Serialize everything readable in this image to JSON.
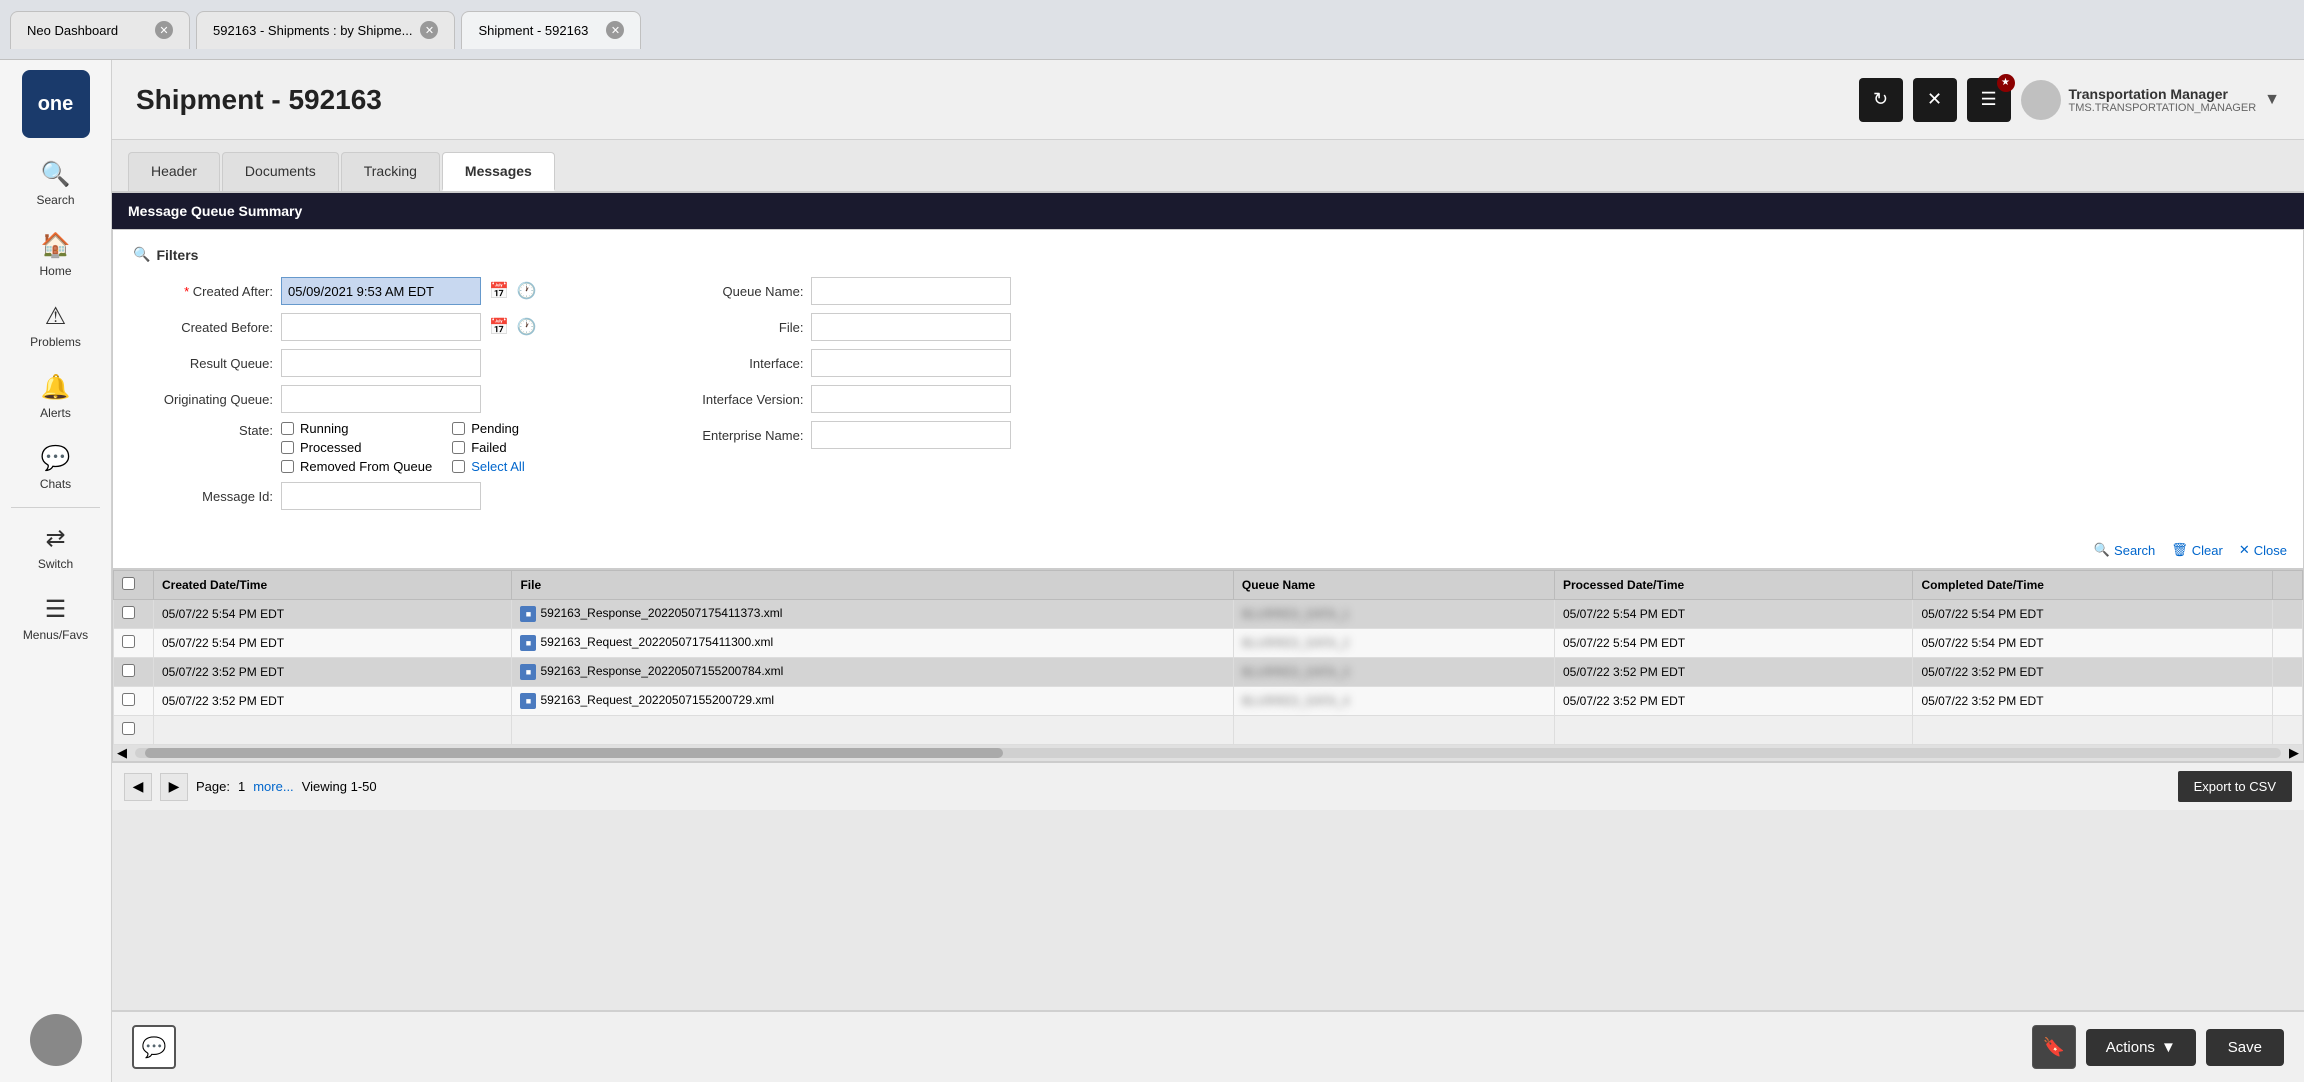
{
  "browser": {
    "tabs": [
      {
        "id": "tab1",
        "label": "Neo Dashboard",
        "active": false
      },
      {
        "id": "tab2",
        "label": "592163 - Shipments : by Shipme...",
        "active": false
      },
      {
        "id": "tab3",
        "label": "Shipment - 592163",
        "active": true
      }
    ]
  },
  "sidebar": {
    "logo": "one",
    "items": [
      {
        "id": "search",
        "label": "Search",
        "icon": "🔍"
      },
      {
        "id": "home",
        "label": "Home",
        "icon": "🏠"
      },
      {
        "id": "problems",
        "label": "Problems",
        "icon": "⚠"
      },
      {
        "id": "alerts",
        "label": "Alerts",
        "icon": "🔔"
      },
      {
        "id": "chats",
        "label": "Chats",
        "icon": "💬"
      },
      {
        "id": "switch",
        "label": "Switch",
        "icon": "⇄"
      },
      {
        "id": "menus",
        "label": "Menus/Favs",
        "icon": "☰"
      }
    ]
  },
  "header": {
    "title": "Shipment - 592163",
    "user": {
      "name": "Transportation Manager",
      "role": "TMS.TRANSPORTATION_MANAGER"
    },
    "buttons": {
      "refresh": "↻",
      "close": "✕",
      "menu": "≡"
    }
  },
  "tabs": [
    {
      "id": "header",
      "label": "Header",
      "active": false
    },
    {
      "id": "documents",
      "label": "Documents",
      "active": false
    },
    {
      "id": "tracking",
      "label": "Tracking",
      "active": false
    },
    {
      "id": "messages",
      "label": "Messages",
      "active": true
    }
  ],
  "messageQueue": {
    "sectionTitle": "Message Queue Summary",
    "filters": {
      "title": "Filters",
      "fields": {
        "createdAfter": {
          "label": "Created After:",
          "required": true,
          "value": "05/09/2021 9:53 AM EDT"
        },
        "createdBefore": {
          "label": "Created Before:",
          "value": ""
        },
        "resultQueue": {
          "label": "Result Queue:",
          "value": ""
        },
        "originatingQueue": {
          "label": "Originating Queue:",
          "value": ""
        },
        "queueName": {
          "label": "Queue Name:",
          "value": ""
        },
        "file": {
          "label": "File:",
          "value": ""
        },
        "interface": {
          "label": "Interface:",
          "value": ""
        },
        "interfaceVersion": {
          "label": "Interface Version:",
          "value": ""
        },
        "enterpriseName": {
          "label": "Enterprise Name:",
          "value": ""
        },
        "messageId": {
          "label": "Message Id:",
          "value": ""
        }
      },
      "state": {
        "label": "State:",
        "options": [
          {
            "id": "running",
            "label": "Running",
            "checked": false
          },
          {
            "id": "pending",
            "label": "Pending",
            "checked": false
          },
          {
            "id": "processed",
            "label": "Processed",
            "checked": false
          },
          {
            "id": "failed",
            "label": "Failed",
            "checked": false
          },
          {
            "id": "removedFromQueue",
            "label": "Removed From Queue",
            "checked": false
          }
        ],
        "selectAll": "Select All"
      },
      "buttons": {
        "search": "Search",
        "clear": "Clear",
        "close": "Close"
      }
    },
    "table": {
      "columns": [
        "",
        "Created Date/Time",
        "File",
        "Queue Name",
        "Processed Date/Time",
        "Completed Date/Time",
        ""
      ],
      "rows": [
        {
          "checkbox": true,
          "createdDateTime": "05/07/22 5:54 PM EDT",
          "file": "592163_Response_20220507175411373.xml",
          "queueName": "BLURRED1",
          "processedDateTime": "05/07/22 5:54 PM EDT",
          "completedDateTime": "05/07/22 5:54 PM EDT",
          "extra": ""
        },
        {
          "checkbox": true,
          "createdDateTime": "05/07/22 5:54 PM EDT",
          "file": "592163_Request_20220507175411300.xml",
          "queueName": "BLURRED2",
          "processedDateTime": "05/07/22 5:54 PM EDT",
          "completedDateTime": "05/07/22 5:54 PM EDT",
          "extra": ""
        },
        {
          "checkbox": true,
          "createdDateTime": "05/07/22 3:52 PM EDT",
          "file": "592163_Response_20220507155200784.xml",
          "queueName": "BLURRED3",
          "processedDateTime": "05/07/22 3:52 PM EDT",
          "completedDateTime": "05/07/22 3:52 PM EDT",
          "extra": ""
        },
        {
          "checkbox": true,
          "createdDateTime": "05/07/22 3:52 PM EDT",
          "file": "592163_Request_20220507155200729.xml",
          "queueName": "BLURRED4",
          "processedDateTime": "05/07/22 3:52 PM EDT",
          "completedDateTime": "05/07/22 3:52 PM EDT",
          "extra": ""
        }
      ]
    },
    "pagination": {
      "currentPage": "1",
      "moreText": "more...",
      "viewingText": "Viewing 1-50",
      "pageLabel": "Page:",
      "exportBtn": "Export to CSV"
    }
  },
  "bottomBar": {
    "actionsLabel": "Actions",
    "saveLabel": "Save"
  }
}
